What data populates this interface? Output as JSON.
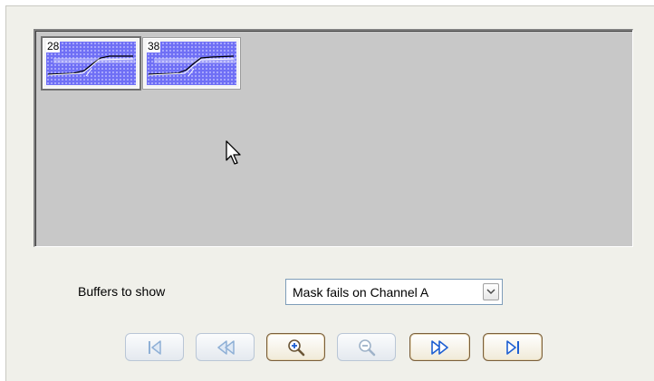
{
  "viewer": {
    "thumbnails": [
      {
        "number": "28",
        "selected": true
      },
      {
        "number": "38",
        "selected": false
      }
    ]
  },
  "controls": {
    "buffers_label": "Buffers to show",
    "buffers_select": {
      "value": "Mask fails on Channel A"
    }
  },
  "navigation": {
    "buttons": [
      {
        "name": "go-to-first",
        "icon": "skip-first-icon",
        "enabled": false
      },
      {
        "name": "previous",
        "icon": "rewind-icon",
        "enabled": false
      },
      {
        "name": "zoom-in",
        "icon": "zoom-in-icon",
        "enabled": true
      },
      {
        "name": "zoom-out",
        "icon": "zoom-out-icon",
        "enabled": false
      },
      {
        "name": "next",
        "icon": "fast-forward-icon",
        "enabled": true
      },
      {
        "name": "go-to-last",
        "icon": "skip-last-icon",
        "enabled": true
      }
    ]
  },
  "colors": {
    "viewer_background": "#c8c8c8",
    "mask_fill": "#6f6ff5",
    "trace": "#000000",
    "disabled_icon": "#8fb0d6",
    "enabled_icon": "#1e5fd2"
  }
}
